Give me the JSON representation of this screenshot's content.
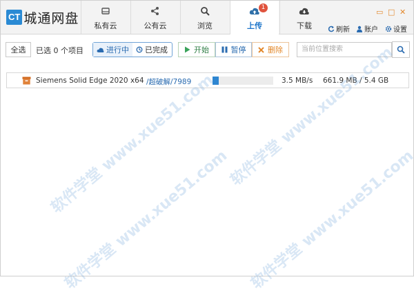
{
  "app": {
    "logo_badge": "CT",
    "logo_text": "城通网盘"
  },
  "tabs": [
    {
      "label": "私有云",
      "icon": "drive-icon"
    },
    {
      "label": "公有云",
      "icon": "share-icon"
    },
    {
      "label": "浏览",
      "icon": "search-icon"
    },
    {
      "label": "上传",
      "icon": "cloud-upload-icon",
      "badge": "1",
      "active": true
    },
    {
      "label": "下载",
      "icon": "cloud-download-icon"
    }
  ],
  "window_controls": {
    "minimize": "▭",
    "maximize": "□",
    "close": "✕"
  },
  "top_links": {
    "refresh": "刷新",
    "account": "账户",
    "settings": "设置"
  },
  "toolbar": {
    "select_all": "全选",
    "selected_count": "已选 0 个项目",
    "in_progress": "进行中",
    "completed": "已完成",
    "start": "开始",
    "pause": "暂停",
    "delete": "删除",
    "search_placeholder": "当前位置搜索"
  },
  "transfers": [
    {
      "name": "Siemens Solid Edge 2020 x64 SS",
      "path": "/超破解/7989",
      "progress": 0.1,
      "speed": "3.5 MB/s",
      "size": "661.9 MB / 5.4 GB"
    }
  ],
  "watermark": "软件学堂 www.xue51.com",
  "colors": {
    "accent": "#2a8ad4",
    "active_tab_text": "#1a73c9",
    "badge": "#e0533d",
    "start_green": "#3aa35a",
    "delete_orange": "#e3882b"
  }
}
